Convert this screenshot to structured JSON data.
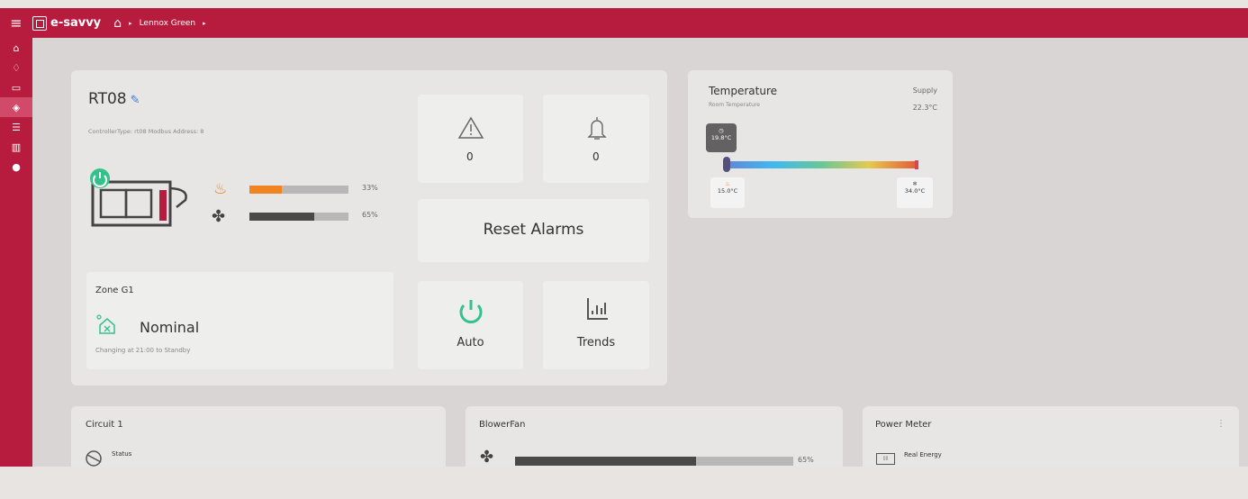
{
  "app": {
    "brand": "e-savvy",
    "breadcrumb": [
      "Lennox Green"
    ]
  },
  "sidebar": {
    "items": [
      {
        "icon": "home-icon"
      },
      {
        "icon": "bell-icon"
      },
      {
        "icon": "calendar-icon"
      },
      {
        "icon": "layers-icon",
        "active": true
      },
      {
        "icon": "list-icon"
      },
      {
        "icon": "chart-icon"
      },
      {
        "icon": "info-icon"
      }
    ]
  },
  "unit": {
    "name": "RT08",
    "controller_info": "ControllerType: rt08    Modbus Address: 8",
    "heat_bar": {
      "percent_text": "33%",
      "value": 0.33
    },
    "fan_bar": {
      "percent_text": "65%",
      "value": 0.65
    }
  },
  "alarms": {
    "warning_count": "0",
    "bell_count": "0",
    "reset_label": "Reset Alarms"
  },
  "zone": {
    "title": "Zone G1",
    "status": "Nominal",
    "detail": "Changing at 21:00 to Standby"
  },
  "controls": {
    "mode_label": "Auto",
    "trends_label": "Trends"
  },
  "temperature": {
    "title": "Temperature",
    "subtitle": "Room Temperature",
    "supply_label": "Supply",
    "supply_value": "22.3°C",
    "current_value": "19.8°C",
    "heat_setpoint": "15.0°C",
    "cool_setpoint": "34.0°C"
  },
  "bottom_cards": {
    "circuit": {
      "title": "Circuit 1",
      "status_label": "Status"
    },
    "blower": {
      "title": "BlowerFan",
      "percent_text": "65%",
      "value": 0.65
    },
    "power": {
      "title": "Power Meter",
      "energy_label": "Real Energy"
    }
  },
  "colors": {
    "brand": "#b71c3e",
    "heat": "#ef8420",
    "fan": "#4a4848",
    "power_on": "#32c28a",
    "edit": "#3d7ad8"
  }
}
